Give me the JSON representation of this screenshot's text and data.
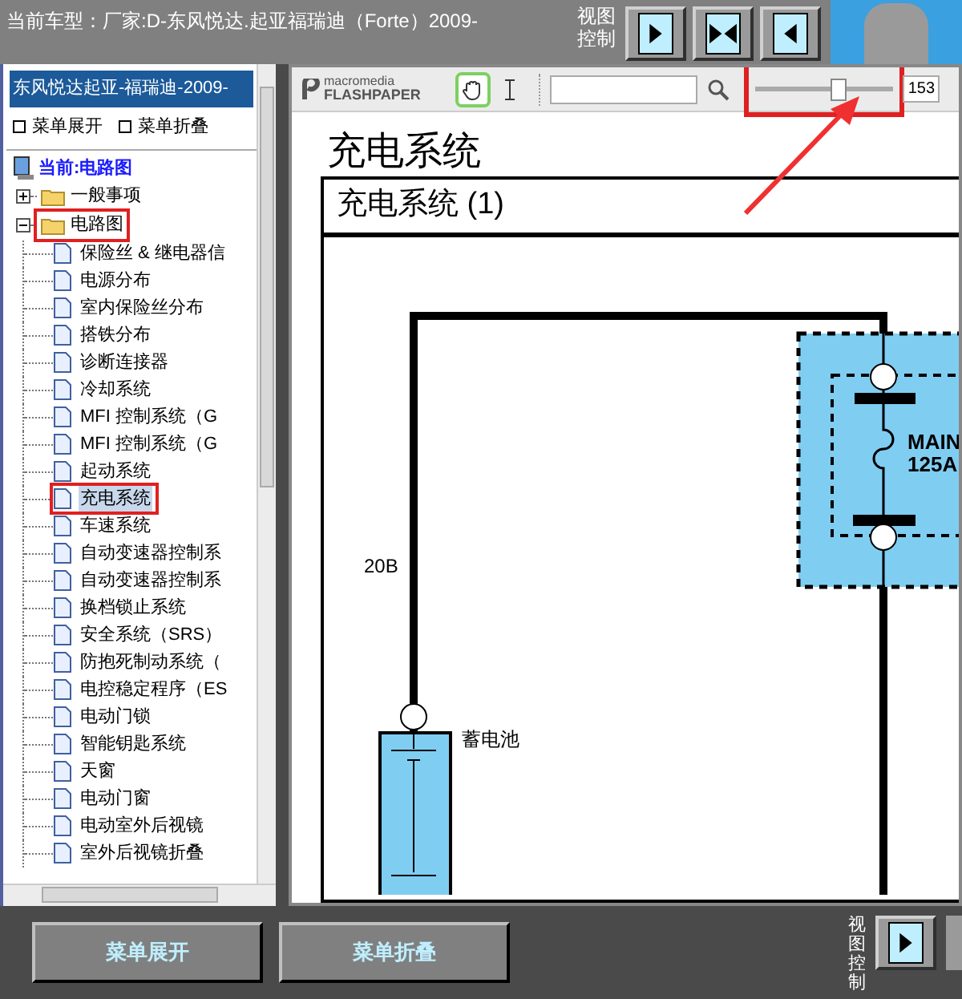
{
  "header": {
    "title": "当前车型：厂家:D-东风悦达.起亚福瑞迪（Forte）2009-",
    "view_label": "视图控制",
    "view_buttons": [
      {
        "kind": "right"
      },
      {
        "kind": "both"
      },
      {
        "kind": "left"
      }
    ]
  },
  "sidebar": {
    "title": "东风悦达起亚-福瑞迪-2009-",
    "links": [
      "菜单展开",
      "菜单折叠"
    ],
    "current": "当前:电路图",
    "tree": [
      {
        "label": "一般事项",
        "expanded": false,
        "highlighted": false
      },
      {
        "label": "电路图",
        "expanded": true,
        "highlighted": true,
        "children": [
          {
            "label": "保险丝 & 继电器信",
            "selected": false,
            "highlighted": false
          },
          {
            "label": "电源分布",
            "selected": false,
            "highlighted": false
          },
          {
            "label": "室内保险丝分布",
            "selected": false,
            "highlighted": false
          },
          {
            "label": "搭铁分布",
            "selected": false,
            "highlighted": false
          },
          {
            "label": "诊断连接器",
            "selected": false,
            "highlighted": false
          },
          {
            "label": "冷却系统",
            "selected": false,
            "highlighted": false
          },
          {
            "label": "MFI 控制系统（G",
            "selected": false,
            "highlighted": false
          },
          {
            "label": "MFI 控制系统（G",
            "selected": false,
            "highlighted": false
          },
          {
            "label": "起动系统",
            "selected": false,
            "highlighted": false
          },
          {
            "label": "充电系统",
            "selected": true,
            "highlighted": true
          },
          {
            "label": "车速系统",
            "selected": false,
            "highlighted": false
          },
          {
            "label": "自动变速器控制系",
            "selected": false,
            "highlighted": false
          },
          {
            "label": "自动变速器控制系",
            "selected": false,
            "highlighted": false
          },
          {
            "label": "换档锁止系统",
            "selected": false,
            "highlighted": false
          },
          {
            "label": "安全系统（SRS）",
            "selected": false,
            "highlighted": false
          },
          {
            "label": "防抱死制动系统（",
            "selected": false,
            "highlighted": false
          },
          {
            "label": "电控稳定程序（ES",
            "selected": false,
            "highlighted": false
          },
          {
            "label": "电动门锁",
            "selected": false,
            "highlighted": false
          },
          {
            "label": "智能钥匙系统",
            "selected": false,
            "highlighted": false
          },
          {
            "label": "天窗",
            "selected": false,
            "highlighted": false
          },
          {
            "label": "电动门窗",
            "selected": false,
            "highlighted": false
          },
          {
            "label": "电动室外后视镜",
            "selected": false,
            "highlighted": false
          },
          {
            "label": "室外后视镜折叠",
            "selected": false,
            "highlighted": false
          }
        ]
      }
    ]
  },
  "viewer": {
    "logo_top": "macromedia",
    "logo_bottom": "FLASHPAPER",
    "hand_tool_active": true,
    "zoom": {
      "level": 0.6,
      "reading": "153",
      "annotated": true
    },
    "page_title": "充电系统",
    "section_title": "充电系统 (1)",
    "diagram_labels": [
      "20B",
      "蓄电池",
      "MAIN",
      "125A"
    ]
  },
  "footer": {
    "buttons": [
      "菜单展开",
      "菜单折叠"
    ],
    "view_label": "视图控制"
  }
}
